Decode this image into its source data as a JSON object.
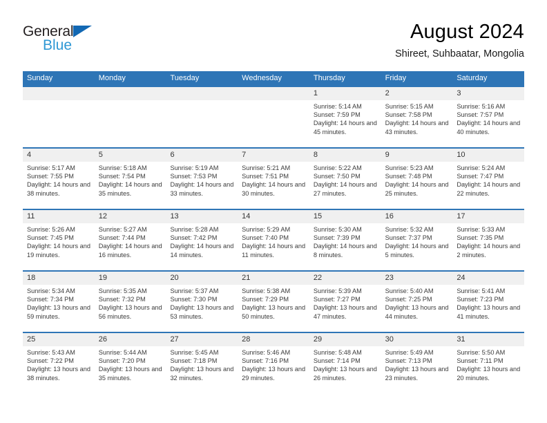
{
  "logo": {
    "primary_text": "General",
    "secondary_text": "Blue",
    "primary_color": "#231f20",
    "secondary_color": "#2e97d4",
    "triangle_color": "#1268b3"
  },
  "header": {
    "title": "August 2024",
    "subtitle": "Shireet, Suhbaatar, Mongolia"
  },
  "theme": {
    "header_blue": "#2e75b6",
    "daynum_band": "#f0f0f0",
    "cell_background": "#ffffff",
    "text_color": "#3a3a3a"
  },
  "weekdays": [
    "Sunday",
    "Monday",
    "Tuesday",
    "Wednesday",
    "Thursday",
    "Friday",
    "Saturday"
  ],
  "labels": {
    "sunrise_prefix": "Sunrise:",
    "sunset_prefix": "Sunset:",
    "daylight_prefix": "Daylight:"
  },
  "weeks": [
    [
      {
        "day": "",
        "sunrise": "",
        "sunset": "",
        "daylight": ""
      },
      {
        "day": "",
        "sunrise": "",
        "sunset": "",
        "daylight": ""
      },
      {
        "day": "",
        "sunrise": "",
        "sunset": "",
        "daylight": ""
      },
      {
        "day": "",
        "sunrise": "",
        "sunset": "",
        "daylight": ""
      },
      {
        "day": "1",
        "sunrise": "Sunrise: 5:14 AM",
        "sunset": "Sunset: 7:59 PM",
        "daylight": "Daylight: 14 hours and 45 minutes."
      },
      {
        "day": "2",
        "sunrise": "Sunrise: 5:15 AM",
        "sunset": "Sunset: 7:58 PM",
        "daylight": "Daylight: 14 hours and 43 minutes."
      },
      {
        "day": "3",
        "sunrise": "Sunrise: 5:16 AM",
        "sunset": "Sunset: 7:57 PM",
        "daylight": "Daylight: 14 hours and 40 minutes."
      }
    ],
    [
      {
        "day": "4",
        "sunrise": "Sunrise: 5:17 AM",
        "sunset": "Sunset: 7:55 PM",
        "daylight": "Daylight: 14 hours and 38 minutes."
      },
      {
        "day": "5",
        "sunrise": "Sunrise: 5:18 AM",
        "sunset": "Sunset: 7:54 PM",
        "daylight": "Daylight: 14 hours and 35 minutes."
      },
      {
        "day": "6",
        "sunrise": "Sunrise: 5:19 AM",
        "sunset": "Sunset: 7:53 PM",
        "daylight": "Daylight: 14 hours and 33 minutes."
      },
      {
        "day": "7",
        "sunrise": "Sunrise: 5:21 AM",
        "sunset": "Sunset: 7:51 PM",
        "daylight": "Daylight: 14 hours and 30 minutes."
      },
      {
        "day": "8",
        "sunrise": "Sunrise: 5:22 AM",
        "sunset": "Sunset: 7:50 PM",
        "daylight": "Daylight: 14 hours and 27 minutes."
      },
      {
        "day": "9",
        "sunrise": "Sunrise: 5:23 AM",
        "sunset": "Sunset: 7:48 PM",
        "daylight": "Daylight: 14 hours and 25 minutes."
      },
      {
        "day": "10",
        "sunrise": "Sunrise: 5:24 AM",
        "sunset": "Sunset: 7:47 PM",
        "daylight": "Daylight: 14 hours and 22 minutes."
      }
    ],
    [
      {
        "day": "11",
        "sunrise": "Sunrise: 5:26 AM",
        "sunset": "Sunset: 7:45 PM",
        "daylight": "Daylight: 14 hours and 19 minutes."
      },
      {
        "day": "12",
        "sunrise": "Sunrise: 5:27 AM",
        "sunset": "Sunset: 7:44 PM",
        "daylight": "Daylight: 14 hours and 16 minutes."
      },
      {
        "day": "13",
        "sunrise": "Sunrise: 5:28 AM",
        "sunset": "Sunset: 7:42 PM",
        "daylight": "Daylight: 14 hours and 14 minutes."
      },
      {
        "day": "14",
        "sunrise": "Sunrise: 5:29 AM",
        "sunset": "Sunset: 7:40 PM",
        "daylight": "Daylight: 14 hours and 11 minutes."
      },
      {
        "day": "15",
        "sunrise": "Sunrise: 5:30 AM",
        "sunset": "Sunset: 7:39 PM",
        "daylight": "Daylight: 14 hours and 8 minutes."
      },
      {
        "day": "16",
        "sunrise": "Sunrise: 5:32 AM",
        "sunset": "Sunset: 7:37 PM",
        "daylight": "Daylight: 14 hours and 5 minutes."
      },
      {
        "day": "17",
        "sunrise": "Sunrise: 5:33 AM",
        "sunset": "Sunset: 7:35 PM",
        "daylight": "Daylight: 14 hours and 2 minutes."
      }
    ],
    [
      {
        "day": "18",
        "sunrise": "Sunrise: 5:34 AM",
        "sunset": "Sunset: 7:34 PM",
        "daylight": "Daylight: 13 hours and 59 minutes."
      },
      {
        "day": "19",
        "sunrise": "Sunrise: 5:35 AM",
        "sunset": "Sunset: 7:32 PM",
        "daylight": "Daylight: 13 hours and 56 minutes."
      },
      {
        "day": "20",
        "sunrise": "Sunrise: 5:37 AM",
        "sunset": "Sunset: 7:30 PM",
        "daylight": "Daylight: 13 hours and 53 minutes."
      },
      {
        "day": "21",
        "sunrise": "Sunrise: 5:38 AM",
        "sunset": "Sunset: 7:29 PM",
        "daylight": "Daylight: 13 hours and 50 minutes."
      },
      {
        "day": "22",
        "sunrise": "Sunrise: 5:39 AM",
        "sunset": "Sunset: 7:27 PM",
        "daylight": "Daylight: 13 hours and 47 minutes."
      },
      {
        "day": "23",
        "sunrise": "Sunrise: 5:40 AM",
        "sunset": "Sunset: 7:25 PM",
        "daylight": "Daylight: 13 hours and 44 minutes."
      },
      {
        "day": "24",
        "sunrise": "Sunrise: 5:41 AM",
        "sunset": "Sunset: 7:23 PM",
        "daylight": "Daylight: 13 hours and 41 minutes."
      }
    ],
    [
      {
        "day": "25",
        "sunrise": "Sunrise: 5:43 AM",
        "sunset": "Sunset: 7:22 PM",
        "daylight": "Daylight: 13 hours and 38 minutes."
      },
      {
        "day": "26",
        "sunrise": "Sunrise: 5:44 AM",
        "sunset": "Sunset: 7:20 PM",
        "daylight": "Daylight: 13 hours and 35 minutes."
      },
      {
        "day": "27",
        "sunrise": "Sunrise: 5:45 AM",
        "sunset": "Sunset: 7:18 PM",
        "daylight": "Daylight: 13 hours and 32 minutes."
      },
      {
        "day": "28",
        "sunrise": "Sunrise: 5:46 AM",
        "sunset": "Sunset: 7:16 PM",
        "daylight": "Daylight: 13 hours and 29 minutes."
      },
      {
        "day": "29",
        "sunrise": "Sunrise: 5:48 AM",
        "sunset": "Sunset: 7:14 PM",
        "daylight": "Daylight: 13 hours and 26 minutes."
      },
      {
        "day": "30",
        "sunrise": "Sunrise: 5:49 AM",
        "sunset": "Sunset: 7:13 PM",
        "daylight": "Daylight: 13 hours and 23 minutes."
      },
      {
        "day": "31",
        "sunrise": "Sunrise: 5:50 AM",
        "sunset": "Sunset: 7:11 PM",
        "daylight": "Daylight: 13 hours and 20 minutes."
      }
    ]
  ]
}
